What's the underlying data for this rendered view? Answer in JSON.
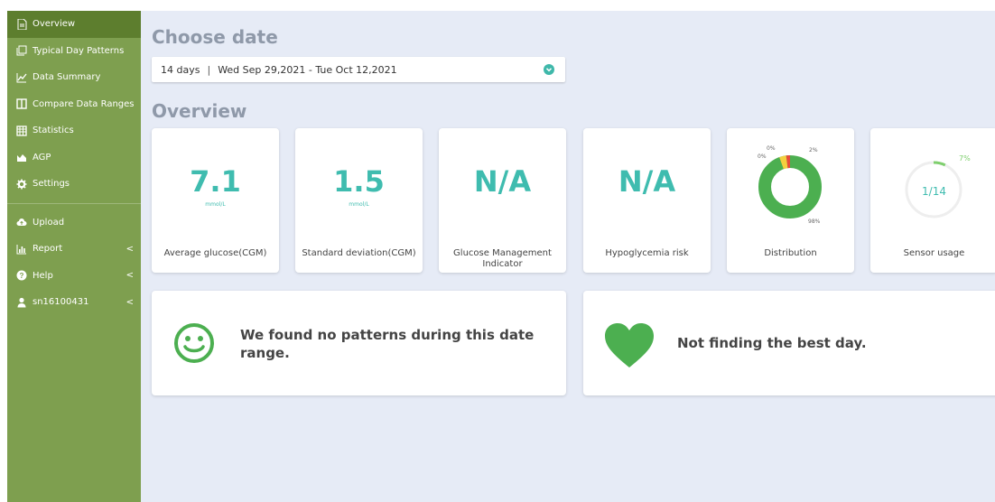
{
  "sidebar": {
    "items": [
      {
        "label": "Overview",
        "icon": "document-icon",
        "active": true
      },
      {
        "label": "Typical Day Patterns",
        "icon": "copy-icon"
      },
      {
        "label": "Data Summary",
        "icon": "line-chart-icon"
      },
      {
        "label": "Compare Data Ranges",
        "icon": "columns-icon"
      },
      {
        "label": "Statistics",
        "icon": "table-icon"
      },
      {
        "label": "AGP",
        "icon": "area-chart-icon"
      },
      {
        "label": "Settings",
        "icon": "gear-icon"
      }
    ],
    "secondary": [
      {
        "label": "Upload",
        "icon": "cloud-upload-icon"
      },
      {
        "label": "Report",
        "icon": "bar-chart-icon",
        "chevron": "<"
      },
      {
        "label": "Help",
        "icon": "question-circle-icon",
        "chevron": "<"
      },
      {
        "label": "sn16100431",
        "icon": "user-icon",
        "chevron": "<"
      }
    ]
  },
  "main": {
    "choose_date_title": "Choose date",
    "date_range": {
      "days": "14 days",
      "separator": "|",
      "range": "Wed Sep 29,2021 - Tue Oct 12,2021"
    },
    "overview_title": "Overview",
    "cards": [
      {
        "value": "7.1",
        "unit": "mmol/L",
        "label": "Average glucose(CGM)"
      },
      {
        "value": "1.5",
        "unit": "mmol/L",
        "label": "Standard deviation(CGM)"
      },
      {
        "value": "N/A",
        "label": "Glucose Management Indicator"
      },
      {
        "value": "N/A",
        "label": "Hypoglycemia risk"
      },
      {
        "label": "Distribution",
        "donut_labels": {
          "low": "0%",
          "very_low": "0%",
          "high": "2%",
          "in_range": "98%"
        }
      },
      {
        "label": "Sensor usage",
        "value": "1/14",
        "percent": "7%"
      }
    ],
    "patterns": [
      {
        "text": "We found no patterns during this date range.",
        "icon": "smiley-icon"
      },
      {
        "text": "Not finding the best day.",
        "icon": "heart-icon"
      }
    ]
  },
  "colors": {
    "sidebar_bg": "#7e9f4f",
    "sidebar_active": "#5d7e2e",
    "main_bg": "#e6ebf6",
    "accent": "#3fbcaf",
    "in_range": "#4caf50",
    "high": "#f4d03f",
    "very_high": "#e74c3c",
    "title_gray": "#8f99a9"
  },
  "chart_data": [
    {
      "type": "pie",
      "title": "",
      "categories": [
        "very_low",
        "low",
        "in_range",
        "high"
      ],
      "values": [
        0,
        0,
        98,
        2
      ]
    },
    {
      "type": "pie",
      "title": "",
      "categories": [
        "used",
        "unused"
      ],
      "values": [
        7,
        93
      ]
    }
  ]
}
